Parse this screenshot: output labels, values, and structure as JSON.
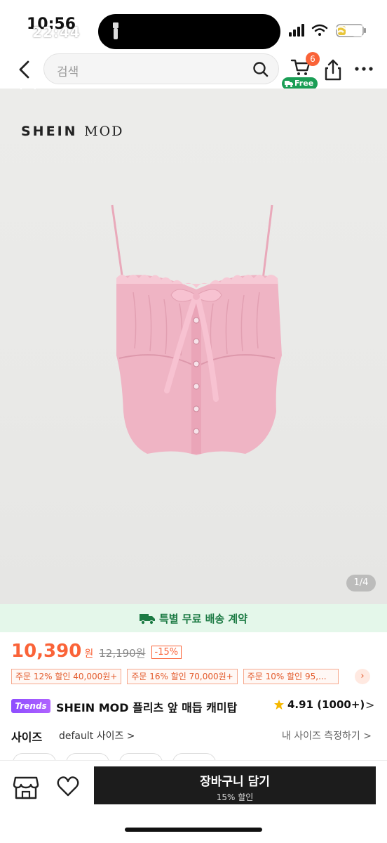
{
  "status_bar": {
    "time_under": "10:56",
    "time_over": "22:44",
    "battery": "24"
  },
  "header": {
    "search_placeholder": "검색",
    "cart_count": "6",
    "free_label": "Free"
  },
  "gallery": {
    "brand_left": "SHEIN",
    "brand_right": "MOD",
    "page_indicator": "1/4"
  },
  "shipping_banner": {
    "text": "특별 무료 배송 계약"
  },
  "price": {
    "current": "10,390",
    "unit": "원",
    "original": "12,190원",
    "discount": "-15%"
  },
  "coupons": [
    {
      "label": "주문 12% 할인 40,000원+"
    },
    {
      "label": "주문 16% 할인 70,000원+"
    },
    {
      "label": "주문 10% 할인 95,..."
    }
  ],
  "coupon_more_icon": "chevron-right-icon",
  "product": {
    "trends_badge": "Trends",
    "title": "SHEIN MOD 플리츠 앞 매듭 캐미탑",
    "rating": "4.91 (1000+)",
    "rating_chevron": ">"
  },
  "size": {
    "label": "사이즈",
    "default_value": "default 사이즈 >",
    "guide_link": "내 사이즈 측정하기 >"
  },
  "bottom_bar": {
    "add_to_cart": "장바구니 담기",
    "add_to_cart_sub": "15% 할인"
  },
  "colors": {
    "accent": "#fa6338",
    "success": "#1b7a43",
    "primary_button": "#1c1c1c",
    "product_pink": "#efb4c4"
  }
}
